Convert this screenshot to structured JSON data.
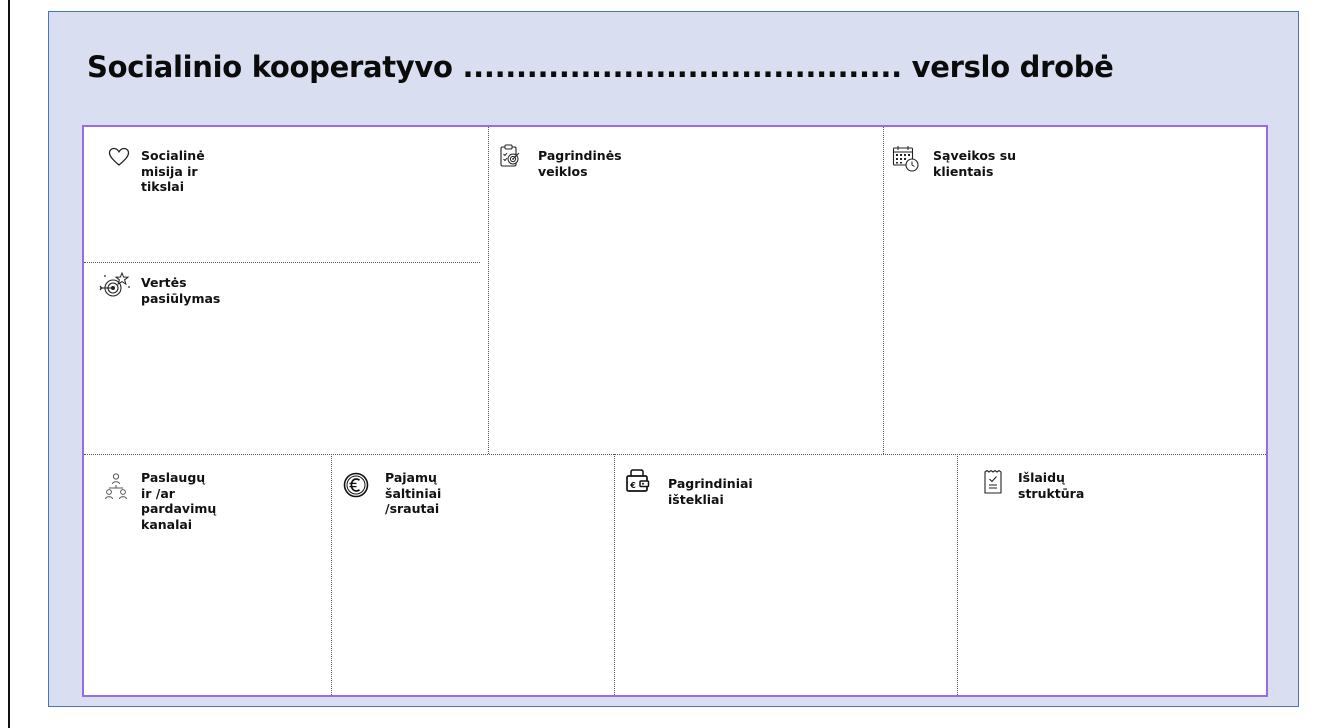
{
  "canvas": {
    "title": "Socialinio kooperatyvo ......................................... verslo drobė",
    "blocks": {
      "mission": {
        "label_lines": [
          "Socialinė",
          "misija ir",
          "tikslai"
        ],
        "icon": "heart-icon"
      },
      "value": {
        "label_lines": [
          "Vertės",
          "pasiūlymas"
        ],
        "icon": "target-star-icon"
      },
      "activities": {
        "label_lines": [
          "Pagrindinės",
          "veiklos"
        ],
        "icon": "clipboard-target-icon"
      },
      "interactions": {
        "label_lines": [
          "Sąveikos su",
          "klientais"
        ],
        "icon": "calendar-clock-icon"
      },
      "channels": {
        "label_lines": [
          "Paslaugų",
          "ir /ar",
          "pardavimų",
          "kanalai"
        ],
        "icon": "people-network-icon"
      },
      "revenue": {
        "label_lines": [
          "Pajamų",
          "šaltiniai",
          "/srautai"
        ],
        "icon": "euro-coin-icon"
      },
      "resources": {
        "label_lines": [
          "Pagrindiniai",
          "ištekliai"
        ],
        "icon": "euro-wallet-icon"
      },
      "costs": {
        "label_lines": [
          "Išlaidų",
          "struktūra"
        ],
        "icon": "receipt-checklist-icon"
      }
    }
  }
}
